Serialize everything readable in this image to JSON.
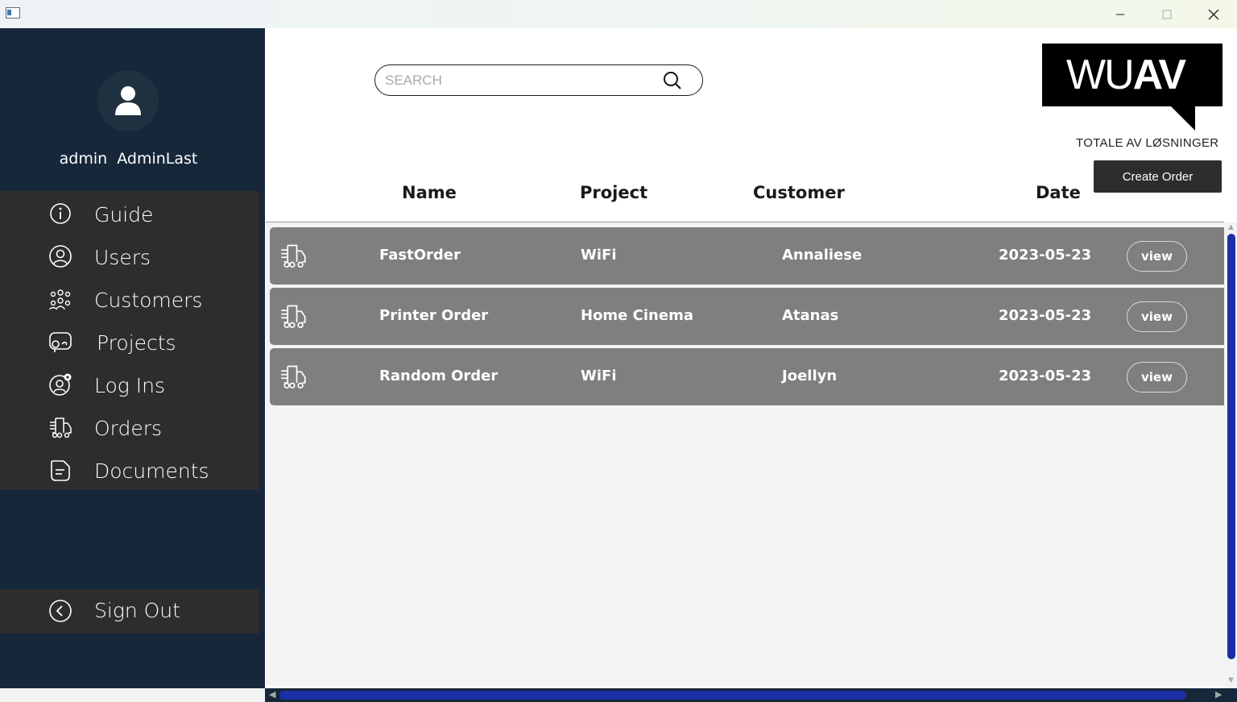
{
  "window": {
    "app_icon": "window-app-icon",
    "controls": [
      "minimize",
      "maximize",
      "close"
    ]
  },
  "sidebar": {
    "user": {
      "first": "admin",
      "last": "AdminLast"
    },
    "items": [
      {
        "label": "Guide",
        "icon": "info-icon"
      },
      {
        "label": "Users",
        "icon": "user-circle-icon"
      },
      {
        "label": "Customers",
        "icon": "group-icon"
      },
      {
        "label": "Projects",
        "icon": "projector-icon"
      },
      {
        "label": "Log Ins",
        "icon": "user-gear-icon"
      },
      {
        "label": "Orders",
        "icon": "delivery-truck-icon"
      },
      {
        "label": "Documents",
        "icon": "document-icon"
      }
    ],
    "sign_out": {
      "label": "Sign Out",
      "icon": "chevron-left-circle-icon"
    }
  },
  "search": {
    "placeholder": "SEARCH"
  },
  "logo": {
    "thin": "WU",
    "bold": "AV",
    "tagline": "TOTALE AV LØSNINGER"
  },
  "create_order_label": "Create Order",
  "columns": {
    "name": "Name",
    "project": "Project",
    "customer": "Customer",
    "date": "Date"
  },
  "orders": [
    {
      "name": "FastOrder",
      "project": "WiFi",
      "customer": "Annaliese",
      "date": "2023-05-23",
      "action": "view"
    },
    {
      "name": "Printer Order",
      "project": "Home Cinema",
      "customer": "Atanas",
      "date": "2023-05-23",
      "action": "view"
    },
    {
      "name": "Random Order",
      "project": "WiFi",
      "customer": "Joellyn",
      "date": "2023-05-23",
      "action": "view"
    }
  ],
  "colors": {
    "sidebar_bg": "#16273a",
    "nav_bg": "#2d2d2d",
    "row_bg": "#7f7f7f",
    "scroll_thumb": "#1d2fa6"
  }
}
